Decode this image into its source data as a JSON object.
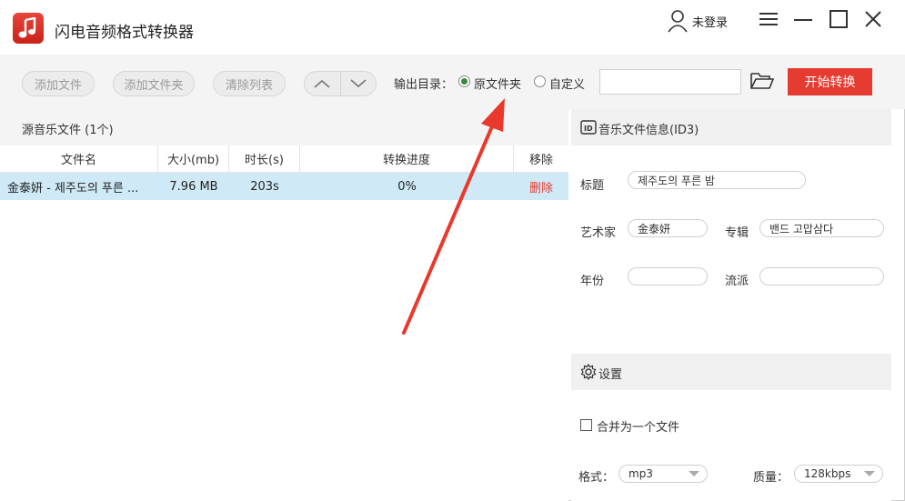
{
  "app": {
    "title": "闪电音频格式转换器"
  },
  "user": {
    "label": "未登录"
  },
  "toolbar": {
    "add_file": "添加文件",
    "add_folder": "添加文件夹",
    "clear_list": "清除列表",
    "output_label": "输出目录：",
    "option_source": "原文件夹",
    "option_custom": "自定义",
    "custom_path_value": "",
    "start_label": "开始转换"
  },
  "file_list": {
    "heading": "源音乐文件 (1个)",
    "columns": [
      "文件名",
      "大小(mb)",
      "时长(s)",
      "转换进度",
      "移除"
    ],
    "rows": [
      {
        "name": "金泰妍 - 제주도의 푸른 ...",
        "size": "7.96 MB",
        "duration": "203s",
        "progress": "0%",
        "remove": "删除"
      }
    ]
  },
  "info": {
    "heading": "音乐文件信息(ID3)",
    "title_label": "标题",
    "title_value": "제주도의 푸른 밤",
    "artist_label": "艺术家",
    "artist_value": "金泰妍",
    "album_label": "专辑",
    "album_value": "밴드 고맙삼다",
    "year_label": "年份",
    "year_value": "",
    "genre_label": "流派",
    "genre_value": ""
  },
  "settings": {
    "heading": "设置",
    "merge_label": "合并为一个文件",
    "merge_checked": false,
    "format_label": "格式：",
    "format_value": "mp3",
    "quality_label": "质量：",
    "quality_value": "128kbps"
  },
  "colors": {
    "accent": "#e63b30",
    "selected_row": "#cfe9f7",
    "annotation_arrow": "#e8392c"
  }
}
